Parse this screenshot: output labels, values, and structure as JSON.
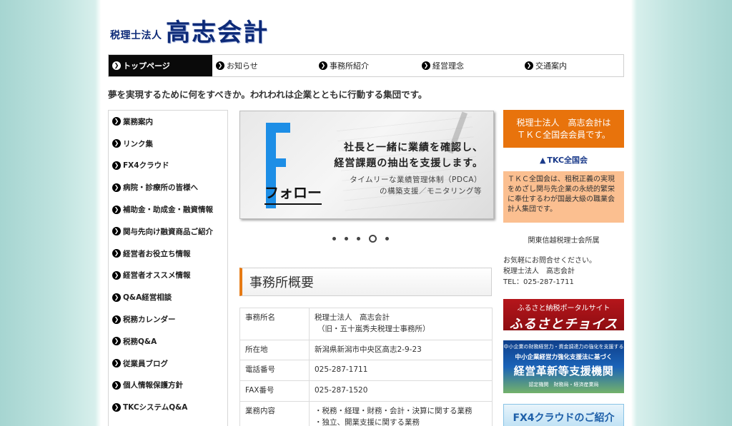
{
  "header": {
    "logo_prefix": "税理士法人",
    "logo_name": "高志会計"
  },
  "nav": [
    {
      "label": "トップページ",
      "active": true
    },
    {
      "label": "お知らせ",
      "active": false
    },
    {
      "label": "事務所紹介",
      "active": false
    },
    {
      "label": "経営理念",
      "active": false
    },
    {
      "label": "交通案内",
      "active": false
    }
  ],
  "tagline": "夢を実現するために何をすべきか。われわれは企業とともに行動する集団です。",
  "sidebar": [
    "業務案内",
    "リンク集",
    "FX4クラウド",
    "病院・診療所の皆様へ",
    "補助金・助成金・融資情報",
    "関与先向け融資商品ご紹介",
    "経営者お役立ち情報",
    "経営者オススメ情報",
    "Q&A経営相談",
    "税務カレンダー",
    "税務Q&A",
    "従業員ブログ",
    "個人情報保護方針",
    "TKCシステムQ&A"
  ],
  "slider": {
    "word": "フォロー",
    "headline_1": "社長と一緒に業績を確認し、",
    "headline_2": "経営課題の抽出を支援します。",
    "sub_1": "タイムリーな業績管理体制（PDCA）",
    "sub_2": "の構築支援／モニタリング等",
    "slide_count": 5,
    "active_slide": 4
  },
  "overview": {
    "title": "事務所概要",
    "rows": [
      {
        "key": "事務所名",
        "value_1": "税理士法人　高志会計",
        "value_2": "（旧・五十嵐秀夫税理士事務所）"
      },
      {
        "key": "所在地",
        "value_1": "新潟県新潟市中央区高志2-9-23",
        "value_2": ""
      },
      {
        "key": "電話番号",
        "value_1": "025-287-1711",
        "value_2": ""
      },
      {
        "key": "FAX番号",
        "value_1": "025-287-1520",
        "value_2": ""
      },
      {
        "key": "業務内容",
        "value_1": "・税務・経理・財務・会計・決算に関する業務",
        "value_2": "・独立、開業支援に関する業務"
      }
    ]
  },
  "right": {
    "member_line_1": "税理士法人　高志会計は",
    "member_line_2": "ＴＫＣ全国会会員です。",
    "tkc_mark": "TKC",
    "tkc_label": "全国会",
    "tkc_desc": "ＴＫＣ全国会は、租税正義の実現をめざし関与先企業の永続的繁栄に奉仕するわが国最大級の職業会計人集団です。",
    "association": "関東信越税理士会所属",
    "contact_1": "お気軽にお問合せください。",
    "contact_2": "税理士法人　高志会計",
    "contact_3": "TEL：025-287-1711"
  },
  "banners": {
    "furusato_1": "ふるさと納税ポータルサイト",
    "furusato_2": "ふるさとチョイス",
    "keiei_1": "中小企業の財務経営力・資金調達力の強化を支援する",
    "keiei_2": "中小企業経営力強化支援法に基づく",
    "keiei_3": "経営革新等支援機関",
    "keiei_4": "認定機関　財務局・経済産業局",
    "fx4": "FX4クラウドのご紹介"
  },
  "colors": {
    "accent_orange": "#e8730c",
    "peach": "#fbbf90",
    "navy": "#0d2a78",
    "slider_blue": "#1d8ee6"
  }
}
